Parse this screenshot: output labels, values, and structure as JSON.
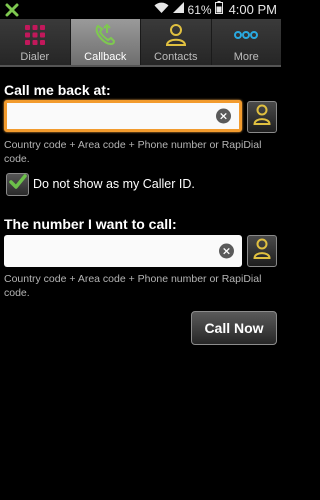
{
  "status_bar": {
    "battery": "61%",
    "time": "4:00 PM",
    "icons": [
      "app-notification-icon",
      "wifi-icon",
      "signal-icon",
      "battery-icon"
    ]
  },
  "tabs": [
    {
      "label": "Dialer",
      "icon": "dialpad-icon",
      "active": false
    },
    {
      "label": "Callback",
      "icon": "callback-phone-icon",
      "active": true
    },
    {
      "label": "Contacts",
      "icon": "person-icon",
      "active": false
    },
    {
      "label": "More",
      "icon": "more-dots-icon",
      "active": false
    }
  ],
  "callback": {
    "label": "Call me back at:",
    "value": "",
    "hint": "Country code + Area code + Phone number or RapiDial code."
  },
  "caller_id": {
    "label": "Do not show as my Caller ID.",
    "checked": true
  },
  "destination": {
    "label": "The number I want to call:",
    "value": "",
    "hint": "Country code + Area code + Phone number or RapiDial code."
  },
  "call_button": {
    "label": "Call Now"
  },
  "colors": {
    "focus_border": "#f29b2e",
    "dialer_icon": "#c2185b",
    "callback_icon": "#7ec850",
    "contacts_icon": "#e0c040",
    "more_icon": "#2aa9e0",
    "check": "#6cc04a"
  }
}
